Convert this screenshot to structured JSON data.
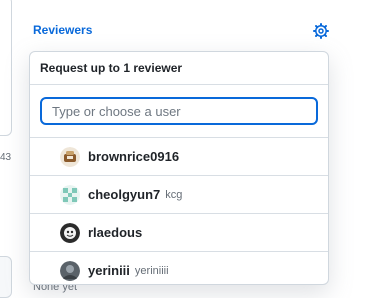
{
  "sidebar": {
    "heading": "Reviewers",
    "status_text": "None yet",
    "left_fragment_text": "43"
  },
  "popover": {
    "header": "Request up to 1 reviewer",
    "filter": {
      "value": "",
      "placeholder": "Type or choose a user"
    },
    "users": [
      {
        "login": "brownrice0916",
        "name": ""
      },
      {
        "login": "cheolgyun7",
        "name": "kcg"
      },
      {
        "login": "rlaedous",
        "name": ""
      },
      {
        "login": "yeriniii",
        "name": "yeriniiii"
      }
    ]
  },
  "colors": {
    "link_blue": "#0969da",
    "border": "#d0d7de",
    "muted_text": "#656d76"
  },
  "icons": {
    "settings": "gear-icon"
  }
}
